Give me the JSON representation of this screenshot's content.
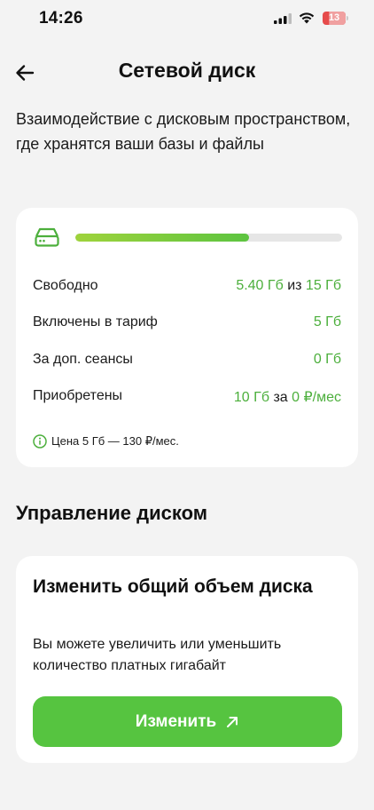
{
  "status_bar": {
    "time": "14:26",
    "battery": "13",
    "icons": [
      "signal-icon",
      "wifi-icon",
      "battery-icon"
    ]
  },
  "header": {
    "title": "Сетевой диск",
    "back_icon": "arrow-left-icon"
  },
  "description": "Взаимодействие с дисковым пространством, где хранятся ваши базы и файлы",
  "disk": {
    "icon": "hard-drive-icon",
    "usage_fraction": 0.65,
    "rows": [
      {
        "label": "Свободно",
        "value": "5.40 Гб",
        "joiner": "из",
        "value2": "15 Гб"
      },
      {
        "label": "Включены в тариф",
        "value": "5 Гб"
      },
      {
        "label": "За доп. сеансы",
        "value": "0 Гб"
      },
      {
        "label": "Приобретены",
        "value": "10 Гб",
        "joiner": "за",
        "value2": "0 ₽/мес"
      }
    ],
    "price_note": "Цена 5 Гб — 130 ₽/мес.",
    "info_icon": "info-icon"
  },
  "section_title": "Управление диском",
  "manage": {
    "title": "Изменить общий объем диска",
    "description": "Вы можете увеличить или уменьшить количество платных гигабайт",
    "button_label": "Изменить",
    "button_icon": "arrow-up-right-icon"
  },
  "colors": {
    "accent": "#56c440",
    "value_green": "#4caf3c",
    "background": "#f3f3f3",
    "card": "#ffffff"
  }
}
